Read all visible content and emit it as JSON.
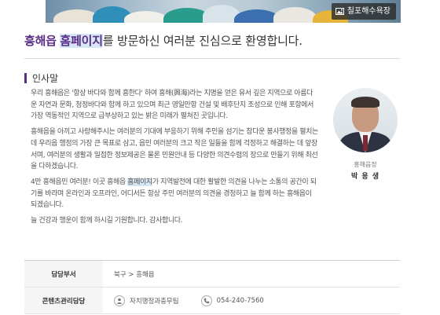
{
  "banner": {
    "tag_label": "칠포해수욕장",
    "tag_icon": "image-icon"
  },
  "headline": {
    "part1": "흥해읍",
    "part2": "홈페이지",
    "part3": "를 방문하신 여러분 진심으로 환영합니다."
  },
  "section": {
    "title": "인사말"
  },
  "greeting": {
    "p1": "우리 흥해읍은 '항상 바다와 함께 흥한다' 하여 흥해(興海)라는 지명을 얻은 유서 깊은 지역으로 아름다운 자연과 문화, 청정바다와 함께 하고 있으며 최근 영일만항 건설 및 배후단지 조성으로 인해 포항에서 가장 역동적인 지역으로 급부상하고 있는 밝은 미래가 펼쳐진 곳입니다.",
    "p2": "흥해읍을 아끼고 사랑해주시는 여러분의 기대에 부응하기 위해 주민을 섬기는 참다운 봉사행정을 펼치는 데 우리읍 행정의 가장 큰 목표로 삼고, 읍민 여러분의 크고 작은 일들을 함께 걱정하고 해결하는 데 앞장서며, 여러분의 생활과 밀접한 정보제공은 물론 민원안내 등 다양한 의견수렴의 장으로 만들기 위해 최선을 다하겠습니다.",
    "p3_a": "4만 흥해읍민 여러분! 이곳 흥해읍 ",
    "p3_hl": "홈페이지",
    "p3_b": "가 지역발전에 대한 활발한 의견을 나누는 소통의 공간이 되기를 바라며 온라인과 오프라인, 어디서든 항상 주민 여러분의 의견을 경청하고 늘 함께 하는 흥해읍이 되겠습니다.",
    "p4": "늘 건강과 행운이 함께 하시길 기원합니다. 감사합니다."
  },
  "profile": {
    "role": "흥해읍장",
    "name": "박 용 생"
  },
  "info": {
    "dept_label": "담당부서",
    "dept_value": "북구 > 흥해읍",
    "manager_label": "콘텐츠관리담당",
    "manager_team": "자치행정과충무팀",
    "manager_phone": "054-240-7560",
    "person_icon": "person-icon",
    "phone_icon": "phone-icon"
  },
  "colors": {
    "accent": "#5a2c86",
    "highlight": "#d6e6f5",
    "table_header_bg": "#f5f5f5"
  }
}
